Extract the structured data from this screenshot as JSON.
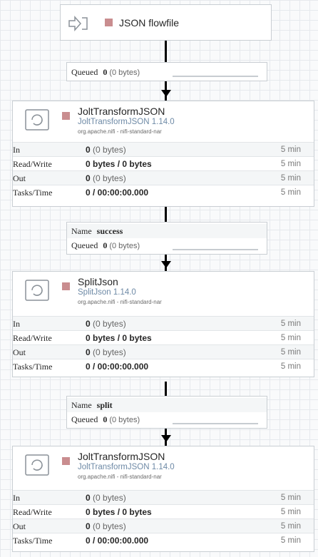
{
  "input_port": {
    "name": "JSON flowfile"
  },
  "connections": [
    {
      "name_key": "",
      "name_value": "",
      "queued_key": "Queued",
      "queued_count": "0",
      "queued_size": "(0 bytes)"
    },
    {
      "name_key": "Name",
      "name_value": "success",
      "queued_key": "Queued",
      "queued_count": "0",
      "queued_size": "(0 bytes)"
    },
    {
      "name_key": "Name",
      "name_value": "split",
      "queued_key": "Queued",
      "queued_count": "0",
      "queued_size": "(0 bytes)"
    }
  ],
  "processors": [
    {
      "name": "JoltTransformJSON",
      "type": "JoltTransformJSON 1.14.0",
      "bundle": "org.apache.nifi - nifi-standard-nar",
      "stats": {
        "in_label": "In",
        "in_count": "0",
        "in_size": "(0 bytes)",
        "in_time": "5 min",
        "rw_label": "Read/Write",
        "rw_value": "0 bytes / 0 bytes",
        "rw_time": "5 min",
        "out_label": "Out",
        "out_count": "0",
        "out_size": "(0 bytes)",
        "out_time": "5 min",
        "tasks_label": "Tasks/Time",
        "tasks_value": "0 / 00:00:00.000",
        "tasks_time": "5 min"
      }
    },
    {
      "name": "SplitJson",
      "type": "SplitJson 1.14.0",
      "bundle": "org.apache.nifi - nifi-standard-nar",
      "stats": {
        "in_label": "In",
        "in_count": "0",
        "in_size": "(0 bytes)",
        "in_time": "5 min",
        "rw_label": "Read/Write",
        "rw_value": "0 bytes / 0 bytes",
        "rw_time": "5 min",
        "out_label": "Out",
        "out_count": "0",
        "out_size": "(0 bytes)",
        "out_time": "5 min",
        "tasks_label": "Tasks/Time",
        "tasks_value": "0 / 00:00:00.000",
        "tasks_time": "5 min"
      }
    },
    {
      "name": "JoltTransformJSON",
      "type": "JoltTransformJSON 1.14.0",
      "bundle": "org.apache.nifi - nifi-standard-nar",
      "stats": {
        "in_label": "In",
        "in_count": "0",
        "in_size": "(0 bytes)",
        "in_time": "5 min",
        "rw_label": "Read/Write",
        "rw_value": "0 bytes / 0 bytes",
        "rw_time": "5 min",
        "out_label": "Out",
        "out_count": "0",
        "out_size": "(0 bytes)",
        "out_time": "5 min",
        "tasks_label": "Tasks/Time",
        "tasks_value": "0 / 00:00:00.000",
        "tasks_time": "5 min"
      }
    }
  ],
  "colors": {
    "stopped_indicator": "#c98d8f",
    "type_text": "#6e8aa6",
    "connection_line": "#000000"
  },
  "icons": {
    "input_port": "input-port-icon",
    "processor": "processor-icon",
    "arrow": "arrow-down-icon"
  }
}
